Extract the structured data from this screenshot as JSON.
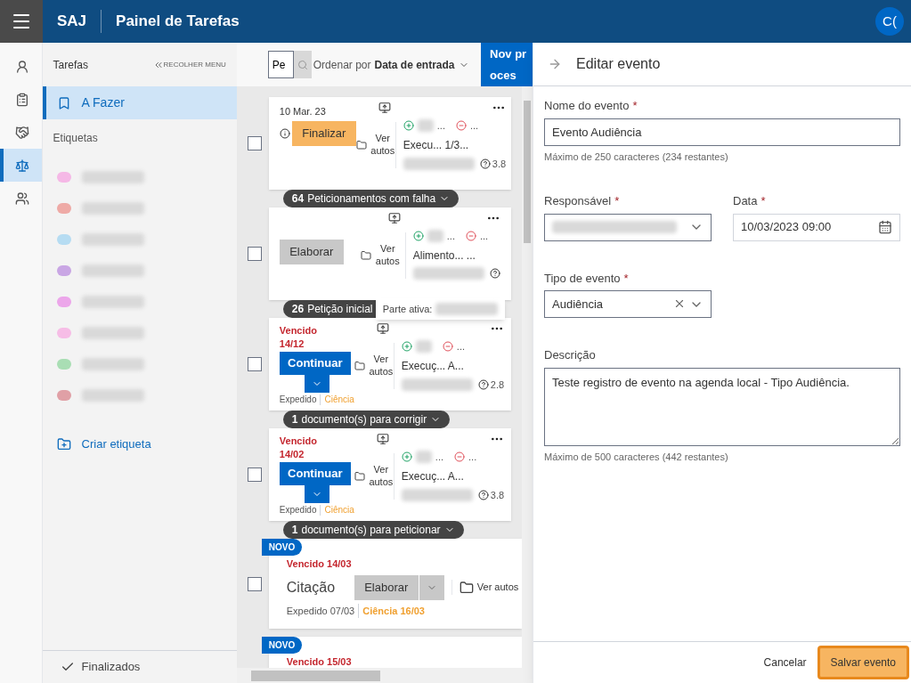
{
  "topbar": {
    "brand": "SAJ",
    "title": "Painel de Tarefas",
    "avatar": "C("
  },
  "rail": [
    {
      "kind": "person",
      "selected": false
    },
    {
      "kind": "clipboard",
      "selected": false
    },
    {
      "kind": "handshake",
      "selected": false
    },
    {
      "kind": "scale",
      "selected": true
    },
    {
      "kind": "people",
      "selected": false
    }
  ],
  "sidebar": {
    "title": "Tarefas",
    "collapse": "RECOLHER MENU",
    "items": [
      {
        "label": "A Fazer",
        "selected": true
      }
    ],
    "labels_title": "Etiquetas",
    "labels": [
      {
        "color": "#f5b8e6"
      },
      {
        "color": "#eeaaa6"
      },
      {
        "color": "#b6dcf2"
      },
      {
        "color": "#c9a6e4"
      },
      {
        "color": "#eca6ea"
      },
      {
        "color": "#f6bde6"
      },
      {
        "color": "#a9deb4"
      },
      {
        "color": "#e0a0a6"
      }
    ],
    "create_label": "Criar etiqueta",
    "finished": "Finalizados"
  },
  "toolbar": {
    "search_value": "Pe",
    "sort_prefix": "Ordenar por",
    "sort_value": "Data de entrada",
    "new_button": "Nov proces"
  },
  "cards": [
    {
      "kind": "compact",
      "checked": false,
      "date": "10 Mar. 23",
      "has_info": true,
      "action": {
        "label": "Finalizar",
        "kind": "finalize"
      },
      "view": "Ver autos",
      "party_active": "...",
      "party_passive": "...",
      "class_text": "Execu... 1/3...",
      "value": "3.8",
      "group": {
        "count": "64",
        "label": "Peticionamentos com falha"
      }
    },
    {
      "kind": "compact",
      "checked": false,
      "action": {
        "label": "Elaborar",
        "kind": "draft"
      },
      "view": "Ver autos",
      "party_active": "...",
      "party_passive": "...",
      "class_text": "Alimento... ...",
      "group": {
        "count": "26",
        "label": "Petição inicial"
      },
      "tooltip": "Parte ativa:"
    },
    {
      "kind": "compact",
      "checked": false,
      "due": "Vencido",
      "due_date": "14/12",
      "action": {
        "label": "Continuar",
        "kind": "continue"
      },
      "view": "Ver autos",
      "party_passive": "...",
      "class_text": "Execuç... A...",
      "value": "2.8",
      "expedited": "Expedido",
      "ciencia": "Ciência",
      "group": {
        "count": "1",
        "label": "documento(s) para corrigir"
      }
    },
    {
      "kind": "compact",
      "checked": false,
      "due": "Vencido",
      "due_date": "14/02",
      "action": {
        "label": "Continuar",
        "kind": "continue"
      },
      "view": "Ver autos",
      "party_active": "...",
      "party_passive": "...",
      "class_text": "Execuç... A...",
      "value": "3.8",
      "expedited": "Expedido",
      "ciencia": "Ciência",
      "group": {
        "count": "1",
        "label": "documento(s) para peticionar"
      }
    },
    {
      "kind": "expanded",
      "checked": false,
      "badge": "NOVO",
      "due": "Vencido 14/03",
      "title": "Citação",
      "action": {
        "label": "Elaborar",
        "kind": "draft"
      },
      "view": "Ver autos",
      "expedited": "Expedido 07/03",
      "ciencia": "Ciência 16/03"
    },
    {
      "kind": "expanded",
      "badge": "NOVO",
      "due": "Vencido 15/03"
    }
  ],
  "panel": {
    "title": "Editar evento",
    "name": {
      "label": "Nome do evento",
      "required": "*",
      "value": "Evento Audiência",
      "hint": "Máximo de 250 caracteres (234 restantes)"
    },
    "owner": {
      "label": "Responsável",
      "required": "*"
    },
    "date": {
      "label": "Data",
      "required": "*",
      "value": "10/03/2023 09:00"
    },
    "type": {
      "label": "Tipo de evento",
      "required": "*",
      "value": "Audiência"
    },
    "description": {
      "label": "Descrição",
      "value": "Teste registro de evento na agenda local - Tipo Audiência.",
      "hint": "Máximo de 500 caracteres (442 restantes)"
    },
    "cancel": "Cancelar",
    "save": "Salvar evento"
  }
}
